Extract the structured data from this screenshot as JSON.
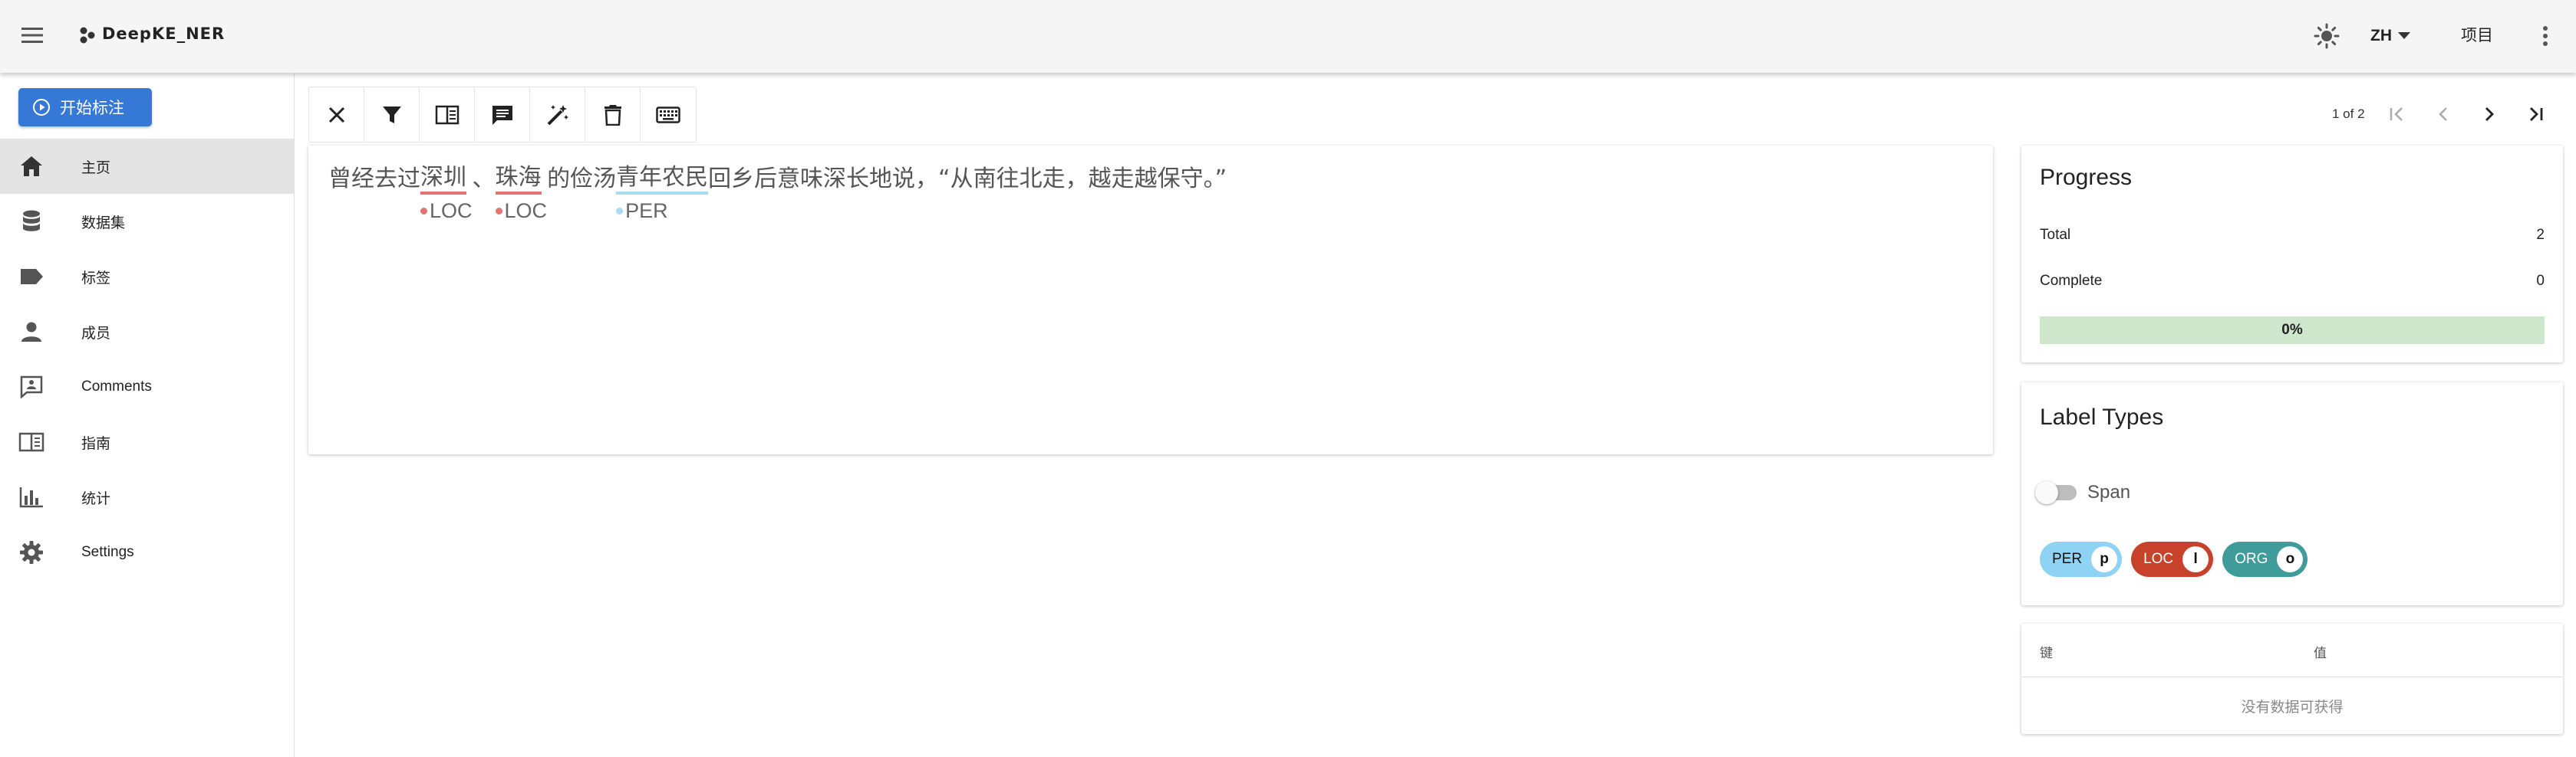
{
  "appbar": {
    "title": "DeepKE_NER",
    "lang": "ZH",
    "project": "项目"
  },
  "sidebar": {
    "start_button": "开始标注",
    "items": [
      {
        "label": "主页",
        "icon": "home-icon",
        "active": true
      },
      {
        "label": "数据集",
        "icon": "database-icon",
        "active": false
      },
      {
        "label": "标签",
        "icon": "label-icon",
        "active": false
      },
      {
        "label": "成员",
        "icon": "person-icon",
        "active": false
      },
      {
        "label": "Comments",
        "icon": "comment-icon",
        "active": false
      },
      {
        "label": "指南",
        "icon": "book-icon",
        "active": false
      },
      {
        "label": "统计",
        "icon": "chart-icon",
        "active": false
      },
      {
        "label": "Settings",
        "icon": "gear-icon",
        "active": false
      }
    ]
  },
  "toolbar": {
    "tools": [
      "close-icon",
      "filter-icon",
      "sidebar-panel-icon",
      "comment-icon",
      "auto-label-wand-icon",
      "delete-icon",
      "keyboard-icon"
    ]
  },
  "pager": {
    "text": "1 of 2"
  },
  "annotation": {
    "segments": [
      {
        "text": "曾经去过",
        "entity": null
      },
      {
        "text": "深圳",
        "entity": "LOC"
      },
      {
        "text": "、",
        "entity": null
      },
      {
        "text": "珠海",
        "entity": "LOC"
      },
      {
        "text": "的俭汤",
        "entity": null
      },
      {
        "text": "青年农民",
        "entity": "PER"
      },
      {
        "text": "回乡后意味深长地说，“从南往北走，越走越保守。”",
        "entity": null
      }
    ]
  },
  "progress": {
    "title": "Progress",
    "total_label": "Total",
    "total_value": "2",
    "complete_label": "Complete",
    "complete_value": "0",
    "percent_text": "0%",
    "percent": 0
  },
  "label_types": {
    "title": "Label Types",
    "switch_label": "Span",
    "switch_on": false,
    "chips": [
      {
        "name": "PER",
        "key": "p",
        "color": "#8fd3f4",
        "text_color": "#111111"
      },
      {
        "name": "LOC",
        "key": "l",
        "color": "#c8412b",
        "text_color": "#ffffff"
      },
      {
        "name": "ORG",
        "key": "o",
        "color": "#3f9c9a",
        "text_color": "#ffffff"
      }
    ]
  },
  "metadata": {
    "key_header": "键",
    "value_header": "值",
    "empty_text": "没有数据可获得"
  },
  "colors": {
    "accent": "#3578d6",
    "loc": "#e57373",
    "per": "#a8dcf2",
    "progress_bg": "#cde6cc"
  }
}
